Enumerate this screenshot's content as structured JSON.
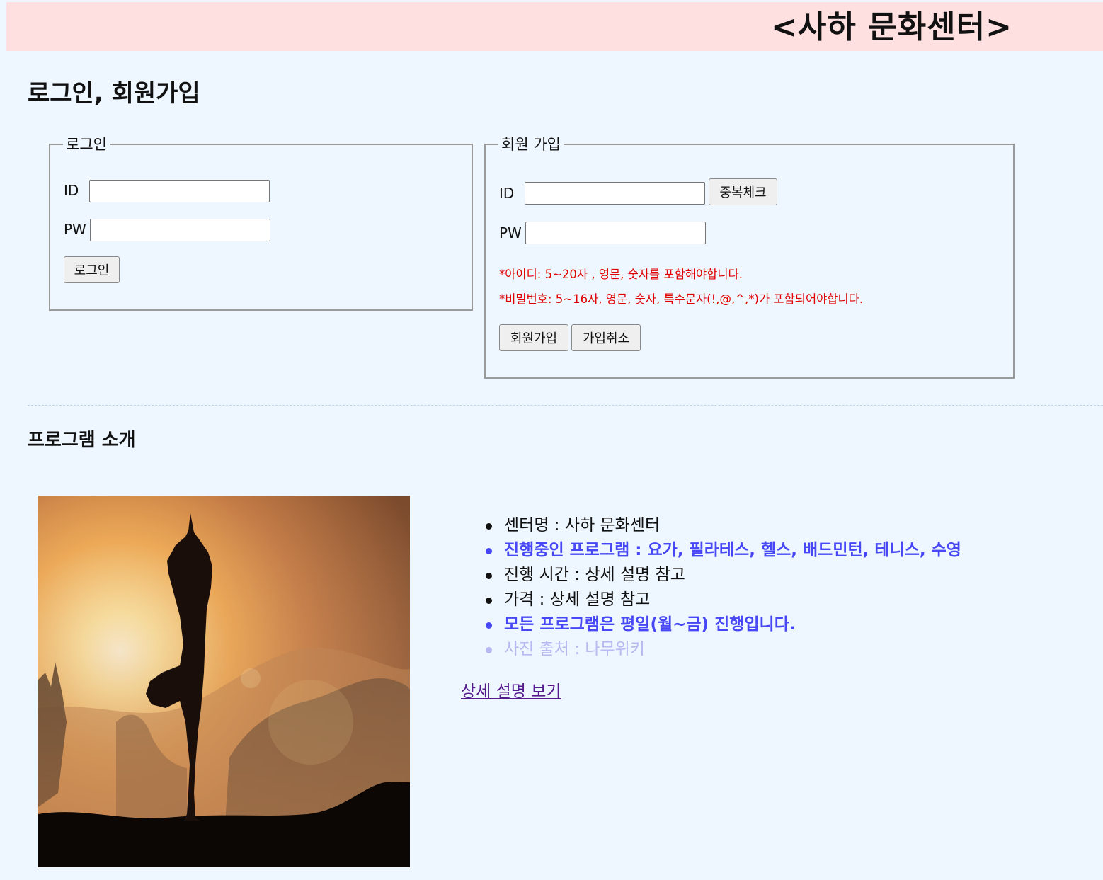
{
  "header": {
    "title": "<사하 문화센터>"
  },
  "page_title": "로그인, 회원가입",
  "login": {
    "legend": "로그인",
    "id_label": "ID",
    "id_value": "",
    "pw_label": "PW",
    "pw_value": "",
    "submit_label": "로그인"
  },
  "signup": {
    "legend": "회원 가입",
    "id_label": "ID",
    "id_value": "",
    "dup_check_label": "중복체크",
    "pw_label": "PW",
    "pw_value": "",
    "id_rule": "*아이디: 5~20자 , 영문, 숫자를 포함해야합니다.",
    "pw_rule": "*비밀번호: 5~16자, 영문, 숫자, 특수문자(!,@,^,*)가 포함되어야합니다.",
    "submit_label": "회원가입",
    "cancel_label": "가입취소"
  },
  "program": {
    "title": "프로그램 소개",
    "photo_icon": "yoga-silhouette-photo",
    "items": [
      {
        "text": "센터명 : 사하 문화센터",
        "style": "normal"
      },
      {
        "text": "진행중인 프로그램 : 요가, 필라테스, 헬스, 배드민턴, 테니스, 수영",
        "style": "highlight"
      },
      {
        "text": "진행 시간 : 상세 설명 참고",
        "style": "normal"
      },
      {
        "text": "가격 : 상세 설명 참고",
        "style": "normal"
      },
      {
        "text": "모든 프로그램은 평일(월~금) 진행입니다.",
        "style": "highlight"
      },
      {
        "text": "사진 출처 : 나무위키",
        "style": "faded"
      }
    ],
    "detail_link": "상세 설명 보기"
  },
  "colors": {
    "header_bg": "#ffe0e0",
    "page_bg": "#eef7ff",
    "highlight": "#4747f5",
    "faded": "#b7b9f0",
    "warning": "#e00000",
    "visited_link": "#551a8b"
  }
}
